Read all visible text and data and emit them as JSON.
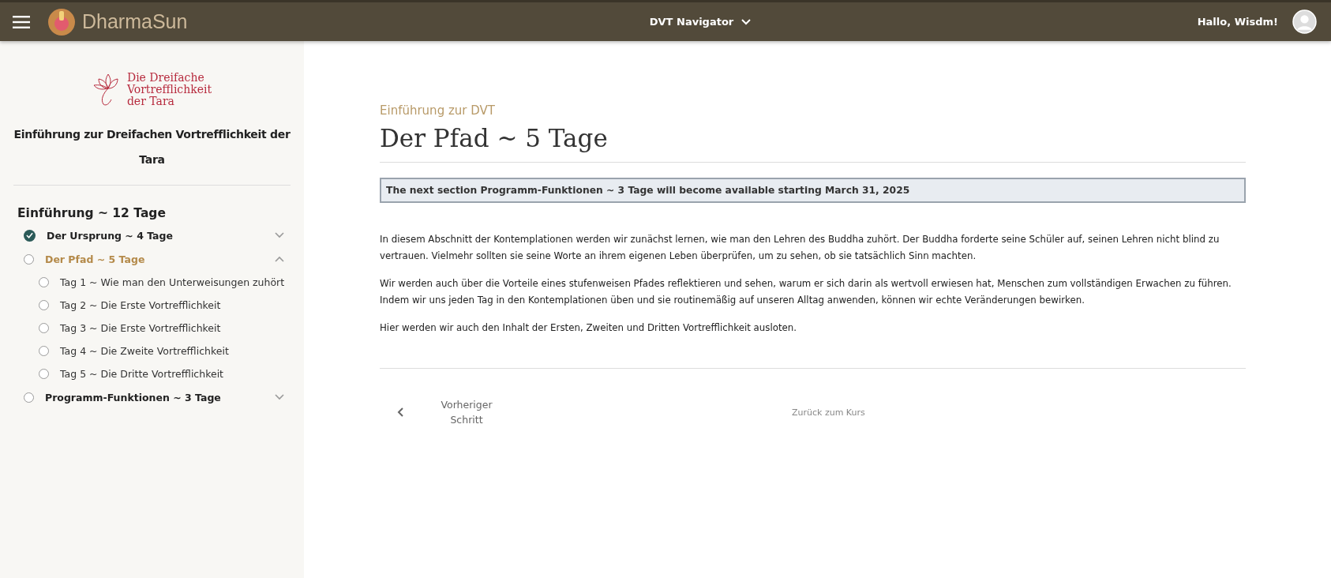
{
  "header": {
    "brand": "DharmaSun",
    "nav_menu": "DVT Navigator",
    "greeting": "Hallo, Wisdm!"
  },
  "sidebar": {
    "logo_lines": [
      "Die Dreifache",
      "Vortrefflichkeit",
      "der Tara"
    ],
    "course_title": "Einführung zur Dreifachen Vortrefflichkeit der Tara",
    "section_title": "Einführung ~ 12 Tage",
    "lessons": [
      {
        "label": "Der Ursprung ~ 4 Tage",
        "completed": true,
        "selected": false,
        "expanded": false
      },
      {
        "label": "Der Pfad ~ 5 Tage",
        "completed": false,
        "selected": true,
        "expanded": true,
        "children": [
          {
            "label": "Tag 1 ~ Wie man den Unterweisungen zuhört",
            "completed": false
          },
          {
            "label": "Tag 2 ~ Die Erste Vortrefflichkeit",
            "completed": false
          },
          {
            "label": "Tag 3 ~ Die Erste Vortrefflichkeit",
            "completed": false
          },
          {
            "label": "Tag 4 ~ Die Zweite Vortrefflichkeit",
            "completed": false
          },
          {
            "label": "Tag 5 ~ Die Dritte Vortrefflichkeit",
            "completed": false
          }
        ]
      },
      {
        "label": "Programm-Funktionen ~ 3 Tage",
        "completed": false,
        "selected": false,
        "expanded": false
      }
    ]
  },
  "main": {
    "breadcrumb": "Einführung zur DVT",
    "title": "Der Pfad ~ 5 Tage",
    "notice": "The next section Programm-Funktionen ~ 3 Tage will become available starting March 31, 2025",
    "paragraphs": [
      "In diesem Abschnitt der Kontemplationen werden wir zunächst lernen, wie man den Lehren des Buddha zuhört. Der Buddha forderte seine Schüler auf, seinen Lehren nicht blind zu vertrauen. Vielmehr sollten sie seine Worte an ihrem eigenen Leben überprüfen, um zu sehen, ob sie tatsächlich Sinn machten.",
      "Wir werden auch über die Vorteile eines stufenweisen Pfades reflektieren und sehen, warum er sich darin als wertvoll erwiesen hat, Menschen zum vollständigen Erwachen zu führen. Indem wir uns jeden Tag in den Kontemplationen üben und sie routinemäßig auf unseren Alltag anwenden, können wir echte Veränderungen bewirken.",
      "Hier werden wir auch den Inhalt der Ersten, Zweiten und Dritten Vortrefflichkeit ausloten."
    ],
    "previous": "Vorheriger Schritt",
    "back": "Zurück zum Kurs"
  }
}
